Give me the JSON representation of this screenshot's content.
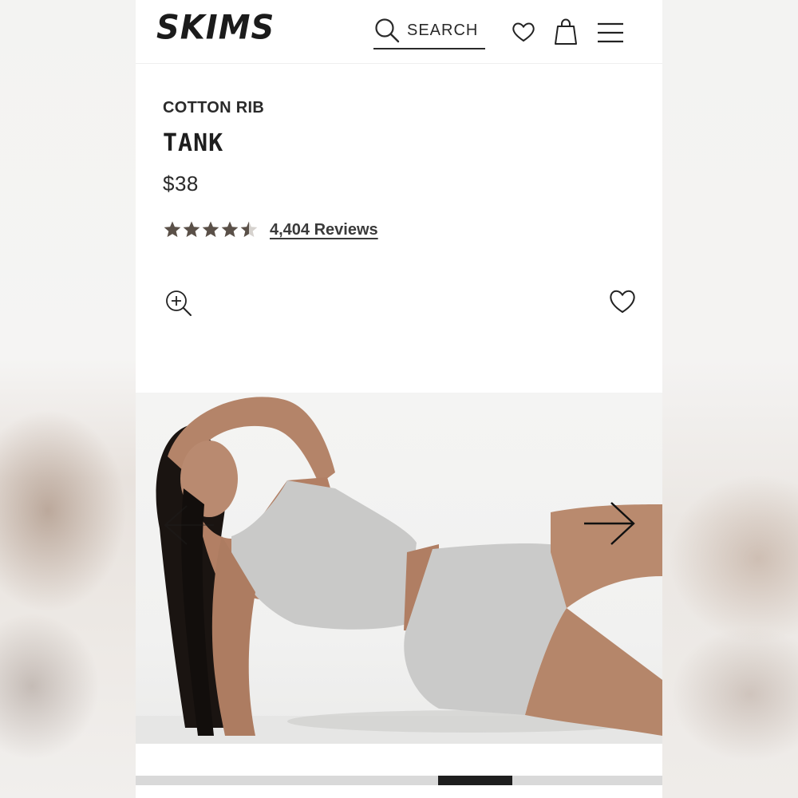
{
  "header": {
    "logo": "SKIMS",
    "search_label": "SEARCH"
  },
  "product": {
    "eyebrow": "COTTON RIB",
    "title": "TANK",
    "price": "$38",
    "rating": 4.5,
    "reviews_label": "4,404 Reviews"
  },
  "icons": {
    "search": "search-icon",
    "wishlist": "heart-icon",
    "bag": "shopping-bag-icon",
    "menu": "hamburger-menu-icon",
    "zoom": "zoom-in-icon",
    "prev": "arrow-left-icon",
    "next": "arrow-right-icon"
  },
  "gallery": {
    "progress": {
      "start_fraction": 0.574,
      "end_fraction": 0.715
    }
  },
  "colors": {
    "text": "#1e1e1e",
    "star": "#5a5048",
    "gallery_bg": "#f2f2f1"
  }
}
